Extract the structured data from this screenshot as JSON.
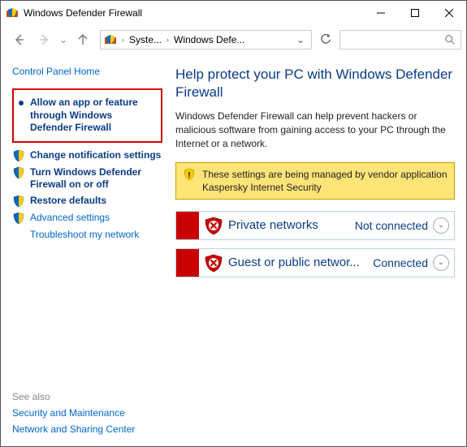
{
  "window": {
    "title": "Windows Defender Firewall"
  },
  "addr": {
    "seg1": "Syste...",
    "seg2": "Windows Defe..."
  },
  "sidebar": {
    "home": "Control Panel Home",
    "allow": "Allow an app or feature through Windows Defender Firewall",
    "notif": "Change notification settings",
    "turn": "Turn Windows Defender Firewall on or off",
    "restore": "Restore defaults",
    "advanced": "Advanced settings",
    "troubleshoot": "Troubleshoot my network"
  },
  "seealso": {
    "heading": "See also",
    "security": "Security and Maintenance",
    "network": "Network and Sharing Center"
  },
  "content": {
    "title": "Help protect your PC with Windows Defender Firewall",
    "desc": "Windows Defender Firewall can help prevent hackers or malicious software from gaining access to your PC through the Internet or a network.",
    "banner": "These settings are being managed by vendor application Kaspersky Internet Security",
    "private": {
      "label": "Private networks",
      "status": "Not connected"
    },
    "guest": {
      "label": "Guest or public networ...",
      "status": "Connected"
    }
  }
}
